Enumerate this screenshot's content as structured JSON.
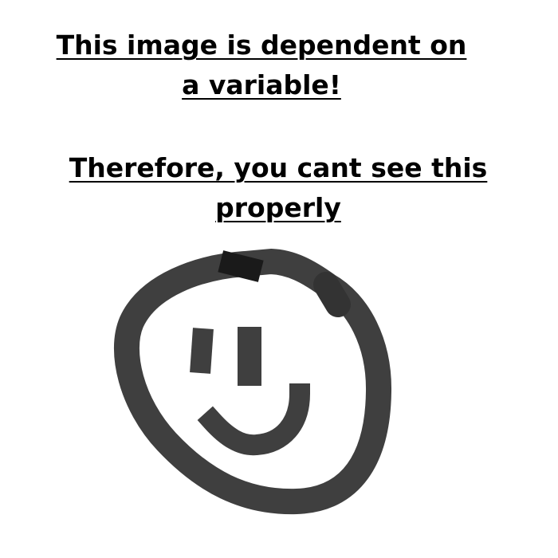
{
  "message": {
    "line1": "This image is dependent on",
    "line2": "a variable!",
    "line3": "Therefore, you cant see this",
    "line4": "properly"
  },
  "drawing": {
    "stroke_color": "#3f3f3f",
    "dark_mark_color": "#1a1a1a",
    "icon": "hand-drawn-smiley-face-icon"
  }
}
